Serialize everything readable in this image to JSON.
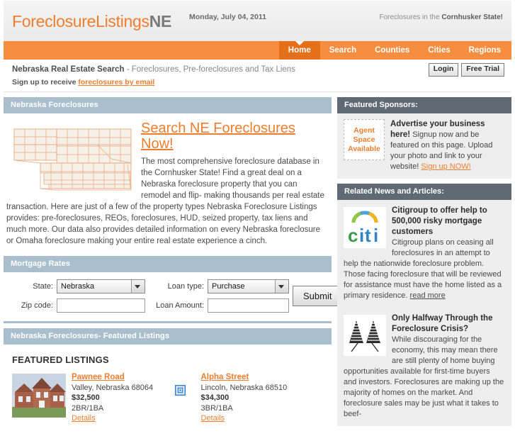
{
  "header": {
    "logo_primary": "ForeclosureListings",
    "logo_suffix": "NE",
    "date": "Monday, July 04, 2011",
    "tagline_prefix": "Foreclosures in the ",
    "tagline_strong": "Cornhusker State!"
  },
  "nav": {
    "items": [
      {
        "label": "Home",
        "active": true
      },
      {
        "label": "Search",
        "active": false
      },
      {
        "label": "Counties",
        "active": false
      },
      {
        "label": "Cities",
        "active": false
      },
      {
        "label": "Regions",
        "active": false
      }
    ]
  },
  "subheader": {
    "title_strong": "Nebraska Real Estate Search",
    "title_rest": " - Foreclosures, Pre-foreclosures and Tax Liens",
    "signup_prefix": "Sign up to receive ",
    "signup_link": "foreclosures by email",
    "login_label": "Login",
    "free_trial_label": "Free Trial"
  },
  "intro": {
    "panel_title": "Nebraska Foreclosures",
    "heading": "Search NE Foreclosures Now!",
    "body": "The most comprehensive foreclosure database in the Cornhusker State! Find a great deal on a Nebraska foreclosure property that you can remodel and flip- making thousands per real estate transaction. Here are just of a few of the property types Nebraska Foreclosure Listings provides: pre-foreclosures, REOs, foreclosures, HUD, seized property, tax liens and much more. Our data also provides detailed information on every Nebraska foreclosure or Omaha foreclosure making your entire real estate experience a cinch."
  },
  "mortgage": {
    "panel_title": "Mortgage Rates",
    "state_label": "State:",
    "state_value": "Nebraska",
    "loan_type_label": "Loan type:",
    "loan_type_value": "Purchase",
    "zip_label": "Zip code:",
    "zip_value": "",
    "zip_placeholder": "",
    "loan_amount_label": "Loan Amount:",
    "loan_amount_value": "",
    "loan_amount_placeholder": "",
    "submit_label": "Submit"
  },
  "featured": {
    "panel_title": "Nebraska Foreclosures- Featured Listings",
    "section_title": "FEATURED LISTINGS",
    "listings": [
      {
        "street": "Pawnee Road ",
        "city_state_zip": "Valley, Nebraska 68064",
        "price": "$32,500",
        "beds_baths": "2BR/1BA",
        "details_label": "Details",
        "thumb": "house-photo"
      },
      {
        "street": "Alpha Street ",
        "city_state_zip": "Lincoln, Nebraska 68510",
        "price": "$34,300",
        "beds_baths": "3BR/1BA",
        "details_label": "Details",
        "thumb": "broken-image"
      }
    ]
  },
  "sponsors": {
    "panel_title": "Featured Sponsors:",
    "agent_box_line1": "Agent",
    "agent_box_line2": "Space",
    "agent_box_line3": "Available",
    "headline": "Advertise your business here!",
    "body": "Signup now and be featured on this page. Upload your photo and link to your website! ",
    "link": "Sign up NOW!"
  },
  "news": {
    "panel_title": "Related News and Articles:",
    "items": [
      {
        "headline": "Citigroup to offer help to 500,000 risky mortgage customers",
        "body": "Citigroup plans on ceasing all foreclosures in an attempt to help the nationwide foreclosure problem. Those facing foreclosure that will be reviewed for assistance must have the home listed as a primary residence. ",
        "read_more": "read more",
        "thumb": "citi-logo"
      },
      {
        "headline": "Only Halfway Through the Foreclosure Crisis?",
        "body": "While discouraging for the economy, this may mean there are still plenty of home buying opportunities available for first-time buyers and investors. Foreclosures are making up the majority of homes on the market. And foreclosure sales may be just what it takes to beef-",
        "read_more": "",
        "thumb": "chart-graphic"
      }
    ]
  },
  "colors": {
    "accent_orange": "#ee7e2d",
    "nav_orange": "#f78d3f",
    "nav_active_orange": "#e4711a",
    "panel_blue": "#aabfcd",
    "panel_gray": "#5f6a74"
  }
}
